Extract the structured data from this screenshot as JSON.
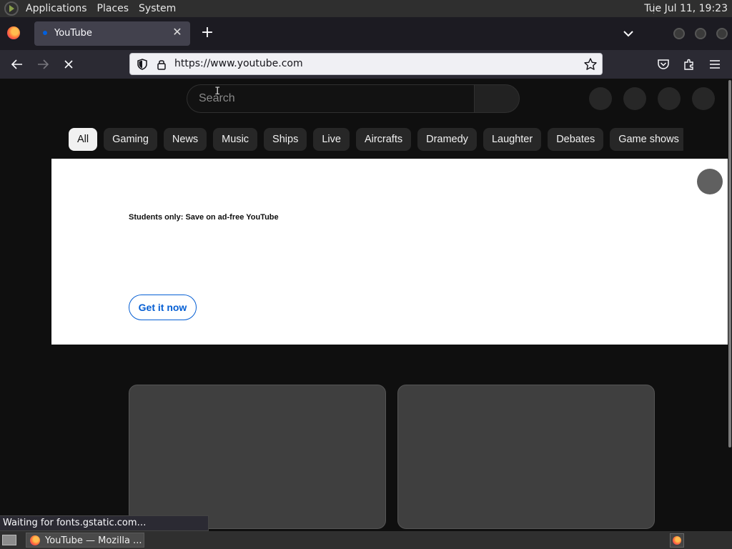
{
  "top_panel": {
    "menus": [
      "Applications",
      "Places",
      "System"
    ],
    "clock": "Tue Jul 11, 19:23"
  },
  "browser": {
    "tab": {
      "title": "YouTube",
      "close_glyph": "✕"
    },
    "new_tab_glyph": "+",
    "url": "https://www.youtube.com",
    "status_text": "Waiting for fonts.gstatic.com…"
  },
  "youtube": {
    "search_placeholder": "Search",
    "chips": [
      "All",
      "Gaming",
      "News",
      "Music",
      "Ships",
      "Live",
      "Aircrafts",
      "Dramedy",
      "Laughter",
      "Debates",
      "Game shows"
    ],
    "active_chip": "All",
    "banner": {
      "headline": "Students only: Save on ad-free YouTube",
      "cta": "Get it now"
    }
  },
  "taskbar": {
    "window_title": "YouTube — Mozilla ..."
  },
  "icons": {
    "back": "arrow-left-icon",
    "forward": "arrow-right-icon",
    "stop": "close-icon",
    "shield": "shield-icon",
    "lock": "lock-icon",
    "bookmark": "star-icon",
    "pocket": "pocket-icon",
    "extensions": "puzzle-icon",
    "menu": "hamburger-icon"
  },
  "colors": {
    "yt_background": "#0f0f0f",
    "chip_bg": "#272727",
    "chip_active_bg": "#f1f1f1",
    "cta_blue": "#065fd4",
    "firefox_toolbar": "#2b2a33"
  }
}
